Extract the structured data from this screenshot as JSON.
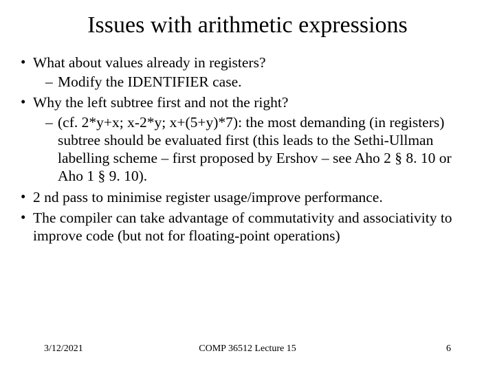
{
  "title": "Issues with arithmetic expressions",
  "bullets": {
    "b0": {
      "text": "What about values already in registers?"
    },
    "s0": {
      "text": "Modify the IDENTIFIER case."
    },
    "b1": {
      "text": "Why the left subtree first and not the right?"
    },
    "s1": {
      "text": "(cf. 2*y+x; x-2*y; x+(5+y)*7): the most demanding (in registers) subtree should be evaluated first (this leads to the Sethi-Ullman labelling scheme – first proposed by Ershov – see Aho 2 § 8. 10 or Aho 1 § 9. 10)."
    },
    "b2": {
      "text": "2 nd pass to minimise register usage/improve performance."
    },
    "b3": {
      "text": "The compiler can take advantage of commutativity and associativity to improve code (but not for floating-point operations)"
    }
  },
  "footer": {
    "date": "3/12/2021",
    "course": "COMP 36512 Lecture 15",
    "page": "6"
  }
}
